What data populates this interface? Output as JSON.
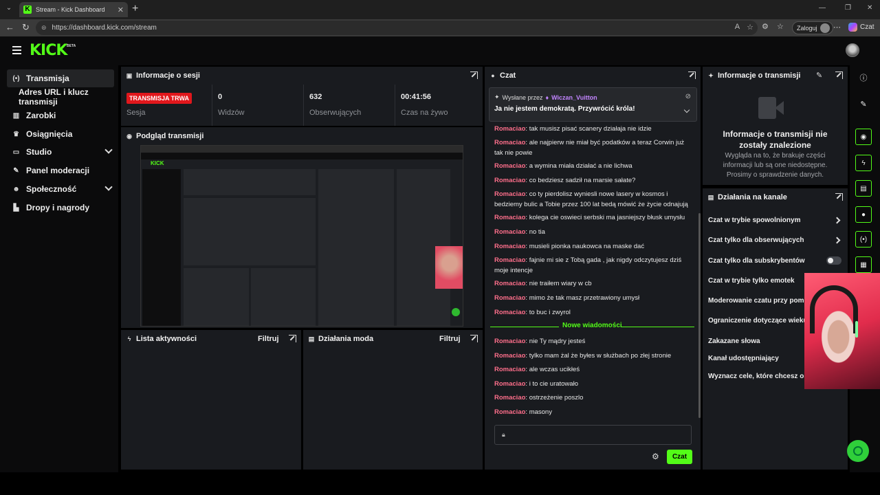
{
  "browser": {
    "tab_title": "Stream - Kick Dashboard",
    "url": "https://dashboard.kick.com/stream",
    "login_label": "Zaloguj",
    "copilot_label": "Czat"
  },
  "header": {
    "logo": "KICK",
    "logo_badge": "BETA"
  },
  "sidebar": {
    "items": [
      {
        "label": "Transmisja",
        "icon": "broadcast-icon"
      },
      {
        "label": "Adres URL i klucz transmisji"
      },
      {
        "label": "Zarobki",
        "icon": "chart-icon"
      },
      {
        "label": "Osiągnięcia",
        "icon": "trophy-icon"
      },
      {
        "label": "Studio",
        "icon": "studio-icon"
      },
      {
        "label": "Panel moderacji",
        "icon": "wrench-icon"
      },
      {
        "label": "Społeczność",
        "icon": "community-icon"
      },
      {
        "label": "Dropy i nagrody",
        "icon": "drops-icon"
      }
    ]
  },
  "session": {
    "title": "Informacje o sesji",
    "live_badge": "TRANSMISJA TRWA",
    "stats": [
      {
        "value": "",
        "label": "Sesja"
      },
      {
        "value": "0",
        "label": "Widzów"
      },
      {
        "value": "632",
        "label": "Obserwujących"
      },
      {
        "value": "00:41:56",
        "label": "Czas na żywo"
      }
    ]
  },
  "preview": {
    "title": "Podgląd transmisji",
    "inner_logo": "KICK"
  },
  "activity": {
    "title": "Lista aktywności",
    "filter": "Filtruj"
  },
  "mod_actions": {
    "title": "Działania moda",
    "filter": "Filtruj"
  },
  "chat": {
    "title": "Czat",
    "pinned": {
      "sent_by": "Wysłane przez",
      "user": "Wiczan_Vuitton",
      "message": "Ja nie jestem demokratą. Przywrócić króla!"
    },
    "messages_before": [
      {
        "user": "Romaciao",
        "text": "tak musisz pisać scanery działaja nie idzie"
      },
      {
        "user": "Romaciao",
        "text": "ale najpierw nie miał być podatków a teraz Corwin już tak nie powie"
      },
      {
        "user": "Romaciao",
        "text": "a wymina miała działać a nie lichwa"
      },
      {
        "user": "Romaciao",
        "text": "co bedziesz sadził na marsie sałate?"
      },
      {
        "user": "Romaciao",
        "text": "co ty pierdolisz wyniesli nowe lasery w kosmos i bedziemy bulic a Tobie przez 100 lat bedą mówić że życie odnajują"
      },
      {
        "user": "Romaciao",
        "text": "kolega cie oswieci serbski ma jasniejszy błusk umysłu"
      },
      {
        "user": "Romaciao",
        "text": "no tia"
      },
      {
        "user": "Romaciao",
        "text": "musieli pionka naukowca na maske dać"
      },
      {
        "user": "Romaciao",
        "text": "fajnie mi sie z Tobą gada , jak nigdy odczytujesz dziś moje intencje"
      },
      {
        "user": "Romaciao",
        "text": "nie traiłem wiary w cb"
      },
      {
        "user": "Romaciao",
        "text": "mimo że tak masz przetrawiony umysł"
      },
      {
        "user": "Romaciao",
        "text": "to buc i zwyrol"
      }
    ],
    "new_messages_label": "Nowe wiadomości",
    "messages_after": [
      {
        "user": "Romaciao",
        "text": "nie Ty mądry jesteś"
      },
      {
        "user": "Romaciao",
        "text": "tylko mam żal że byłes w służbach po złej stronie"
      },
      {
        "user": "Romaciao",
        "text": "ale wczas ucikłeś"
      },
      {
        "user": "Romaciao",
        "text": "i to cie uratowało"
      },
      {
        "user": "Romaciao",
        "text": "ostrzeżenie poszlo"
      },
      {
        "user": "Romaciao",
        "text": "masony"
      }
    ],
    "send_label": "Czat"
  },
  "stream_info": {
    "title": "Informacje o transmisji",
    "empty_title": "Informacje o transmisji nie zostały znalezione",
    "empty_desc": "Wygląda na to, że brakuje części informacji lub są one niedostępne. Prosimy o sprawdzenie danych."
  },
  "channel_actions": {
    "title": "Działania na kanale",
    "items": [
      {
        "label": "Czat w trybie spowolnionym",
        "control": "chevron"
      },
      {
        "label": "Czat tylko dla obserwujących",
        "control": "chevron"
      },
      {
        "label": "Czat tylko dla subskrybentów",
        "control": "toggle",
        "enabled": false
      },
      {
        "label": "Czat w trybie tylko emotek"
      },
      {
        "label": "Moderowanie czatu przy pomocy"
      },
      {
        "label": "Ograniczenie dotyczące wieku"
      },
      {
        "label": "Zakazane słowa"
      },
      {
        "label": "Kanał udostępniający"
      },
      {
        "label": "Wyznacz cele, które chcesz osiągnąć"
      }
    ]
  },
  "colors": {
    "accent": "#53fc18",
    "live": "#e1171c",
    "chat_user": "#ff6f8b",
    "pinned_user": "#c285ff",
    "panel": "#191b1f"
  }
}
